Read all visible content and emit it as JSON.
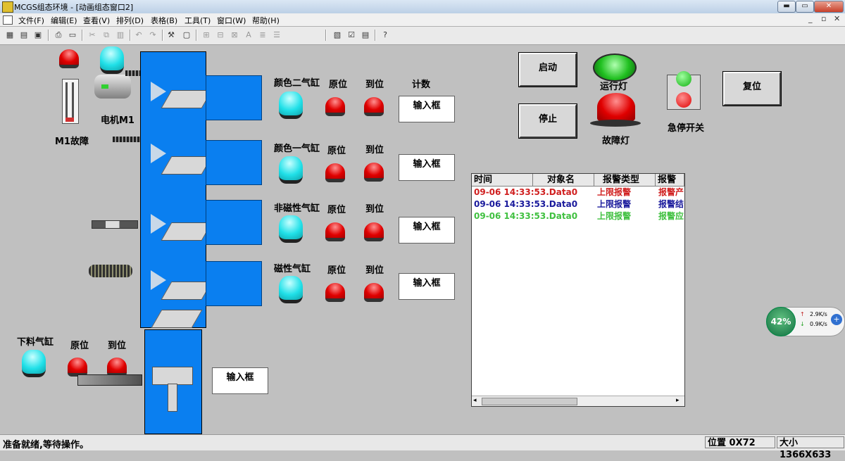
{
  "window": {
    "title": "MCGS组态环境 - [动画组态窗口2]"
  },
  "menu": [
    "文件(F)",
    "编辑(E)",
    "查看(V)",
    "排列(D)",
    "表格(B)",
    "工具(T)",
    "窗口(W)",
    "帮助(H)"
  ],
  "toolbar": [
    "save-icon",
    "open-icon",
    "disk-icon",
    "print-icon",
    "preview-icon",
    "cut-icon",
    "copy-icon",
    "paste-icon",
    "undo-icon",
    "redo-icon",
    "tools-icon",
    "frame-icon",
    "align-icon",
    "align2-icon",
    "font-icon",
    "list-icon",
    "list2-icon",
    "props-icon",
    "check-icon",
    "edit-icon",
    "help-icon"
  ],
  "labels": {
    "motor": "电机M1",
    "m1fault": "M1故障",
    "unload": "下料气缸",
    "orig": "原位",
    "reach": "到位",
    "count": "计数",
    "inbox": "输入框"
  },
  "stations": [
    {
      "name": "颜色二气缸",
      "orig": "原位",
      "reach": "到位",
      "count": "计数"
    },
    {
      "name": "颜色一气缸",
      "orig": "原位",
      "reach": "到位"
    },
    {
      "name": "非磁性气缸",
      "orig": "原位",
      "reach": "到位"
    },
    {
      "name": "磁性气缸",
      "orig": "原位",
      "reach": "到位"
    }
  ],
  "buttons": {
    "start": "启动",
    "stop": "停止",
    "reset": "复位"
  },
  "indicators": {
    "run": "运行灯",
    "fault": "故障灯",
    "estop": "急停开关"
  },
  "alarm": {
    "headers": [
      "时间",
      "对象名",
      "报警类型",
      "报警"
    ],
    "rows": [
      {
        "time": "09-06 14:33:53.Data0",
        "type": "上限报警",
        "msg": "报警产",
        "color": "#d02020"
      },
      {
        "time": "09-06 14:33:53.Data0",
        "type": "上限报警",
        "msg": "报警结",
        "color": "#1a1a9c"
      },
      {
        "time": "09-06 14:33:53.Data0",
        "type": "上限报警",
        "msg": "报警应",
        "color": "#40c040"
      }
    ]
  },
  "net": {
    "percent": "42%",
    "up": "2.9K/s",
    "down": "0.9K/s"
  },
  "status": {
    "left": "准备就绪,等待操作。",
    "position": "位置 0X72",
    "size": "大小 1366X633"
  }
}
